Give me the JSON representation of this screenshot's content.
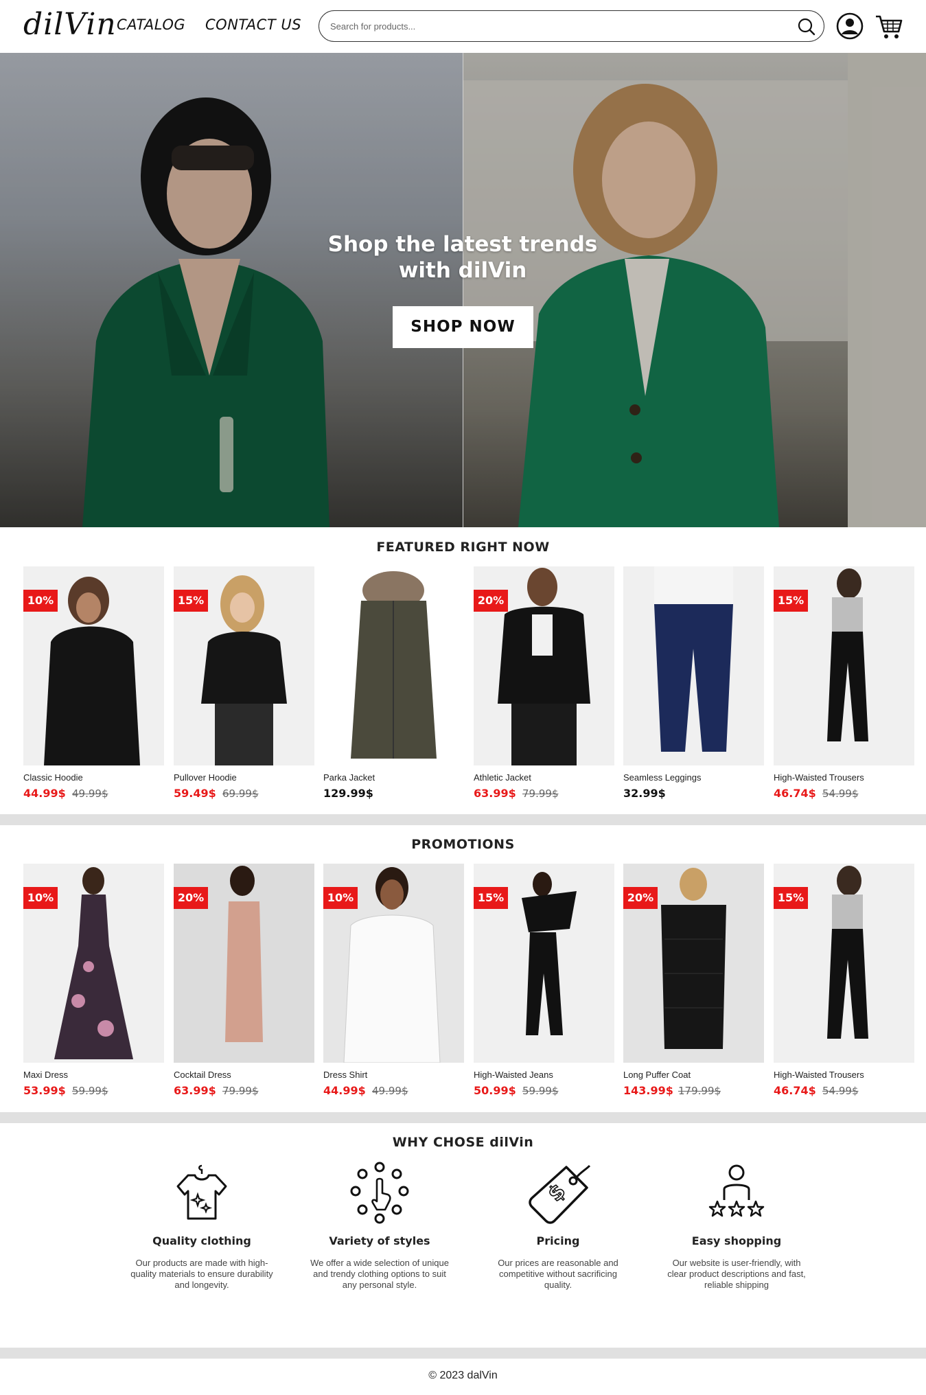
{
  "header": {
    "logo": "dilVin",
    "nav": [
      "CATALOG",
      "CONTACT US"
    ],
    "search_placeholder": "Search for products..."
  },
  "hero": {
    "title_line1": "Shop the latest trends",
    "title_line2": "with dilVin",
    "cta": "SHOP NOW"
  },
  "featured": {
    "title": "FEATURED RIGHT NOW",
    "items": [
      {
        "name": "Classic Hoodie",
        "price": "44.99$",
        "old_price": "49.99$",
        "badge": "10%"
      },
      {
        "name": "Pullover Hoodie",
        "price": "59.49$",
        "old_price": "69.99$",
        "badge": "15%"
      },
      {
        "name": "Parka Jacket",
        "price": "129.99$",
        "old_price": "",
        "badge": ""
      },
      {
        "name": "Athletic Jacket",
        "price": "63.99$",
        "old_price": "79.99$",
        "badge": "20%"
      },
      {
        "name": "Seamless Leggings",
        "price": "32.99$",
        "old_price": "",
        "badge": ""
      },
      {
        "name": "High-Waisted Trousers",
        "price": "46.74$",
        "old_price": "54.99$",
        "badge": "15%"
      }
    ]
  },
  "promotions": {
    "title": "PROMOTIONS",
    "items": [
      {
        "name": "Maxi Dress",
        "price": "53.99$",
        "old_price": "59.99$",
        "badge": "10%"
      },
      {
        "name": "Cocktail Dress",
        "price": "63.99$",
        "old_price": "79.99$",
        "badge": "20%"
      },
      {
        "name": "Dress Shirt",
        "price": "44.99$",
        "old_price": "49.99$",
        "badge": "10%"
      },
      {
        "name": "High-Waisted Jeans",
        "price": "50.99$",
        "old_price": "59.99$",
        "badge": "15%"
      },
      {
        "name": "Long Puffer Coat",
        "price": "143.99$",
        "old_price": "179.99$",
        "badge": "20%"
      },
      {
        "name": "High-Waisted Trousers",
        "price": "46.74$",
        "old_price": "54.99$",
        "badge": "15%"
      }
    ]
  },
  "why": {
    "title": "WHY CHOSE dilVin",
    "features": [
      {
        "icon": "shirt-sparkle-icon",
        "title": "Quality clothing",
        "text": "Our products are made with high-quality materials to ensure durability and longevity."
      },
      {
        "icon": "hand-tap-icon",
        "title": "Variety of styles",
        "text": "We offer a wide selection of unique and trendy clothing options to suit any personal style."
      },
      {
        "icon": "price-tag-icon",
        "title": "Pricing",
        "text": "Our prices are reasonable and competitive without sacrificing quality."
      },
      {
        "icon": "user-rating-icon",
        "title": "Easy shopping",
        "text": "Our website is user-friendly, with clear product descriptions and fast, reliable shipping"
      }
    ]
  },
  "footer": {
    "copyright": "© 2023 dalVin"
  },
  "colors": {
    "accent": "#e81919",
    "divider": "#e0e0e0",
    "text": "#222222"
  }
}
